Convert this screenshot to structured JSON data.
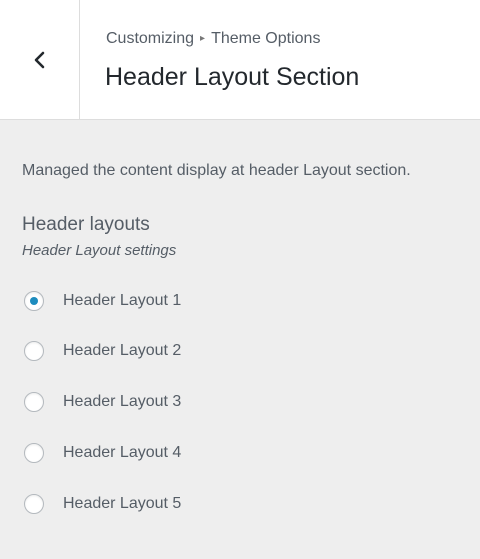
{
  "header": {
    "breadcrumb_root": "Customizing",
    "breadcrumb_separator": "▸",
    "breadcrumb_section": "Theme Options",
    "title": "Header Layout Section"
  },
  "section": {
    "description": "Managed the content display at header Layout section.",
    "setting_title": "Header layouts",
    "setting_subtitle": "Header Layout settings",
    "selected_option": "Header Layout 1",
    "options": [
      {
        "label": "Header Layout 1",
        "checked": true
      },
      {
        "label": "Header Layout 2",
        "checked": false
      },
      {
        "label": "Header Layout 3",
        "checked": false
      },
      {
        "label": "Header Layout 4",
        "checked": false
      },
      {
        "label": "Header Layout 5",
        "checked": false
      }
    ]
  },
  "colors": {
    "accent": "#1e8cbe",
    "panel_background": "#eeeeee",
    "header_background": "#ffffff"
  }
}
